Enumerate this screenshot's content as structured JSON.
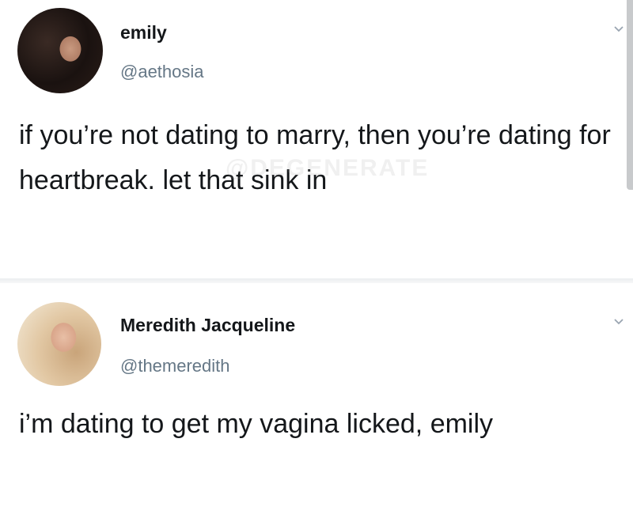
{
  "tweets": [
    {
      "author": "emily",
      "handle": "@aethosia",
      "text": "if you’re not dating to marry, then you’re dating for heartbreak. let that sink in",
      "avatar": "profile-photo-dark-hair",
      "menu_icon": "chevron-down-icon"
    },
    {
      "author": "Meredith Jacqueline",
      "handle": "@themeredith",
      "text": "i’m dating to get my vagina licked, emily",
      "avatar": "profile-photo-blonde-hair",
      "menu_icon": "chevron-down-icon"
    }
  ],
  "watermark_text": "@DEGENERATE",
  "colors": {
    "text": "#14171a",
    "secondary": "#657786",
    "chevron": "#9aa5b1",
    "divider": "#eceef0"
  }
}
